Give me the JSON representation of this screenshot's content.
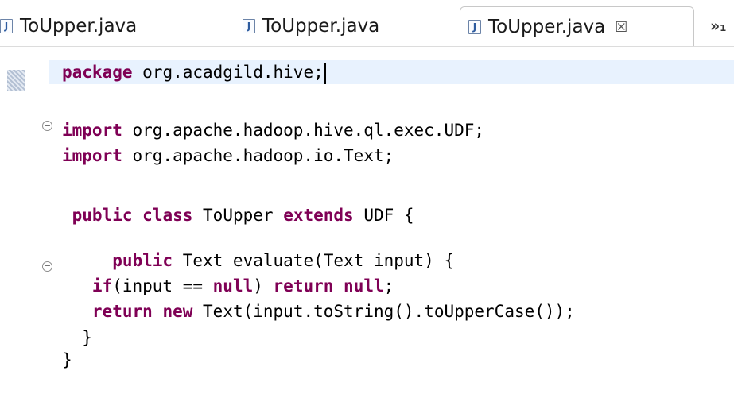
{
  "tabs": [
    {
      "label": "ToUpper.java",
      "icon": "java-file-icon",
      "active": false
    },
    {
      "label": "ToUpper.java",
      "icon": "java-file-icon",
      "active": false
    },
    {
      "label": "ToUpper.java",
      "icon": "java-file-icon",
      "active": true,
      "close_glyph": "☒"
    }
  ],
  "tab_icon_letter": "J",
  "more_tabs_label": "»₁",
  "colors": {
    "keyword": "#7f0055",
    "text": "#000000",
    "current_line_highlight": "#e8f2fe"
  },
  "code_lines": [
    {
      "tokens": [
        {
          "t": "package",
          "kw": true
        },
        {
          "t": " org.acadgild.hive;"
        }
      ]
    },
    {
      "tokens": []
    },
    {
      "tokens": [
        {
          "t": "import",
          "kw": true
        },
        {
          "t": " org.apache.hadoop.hive.ql.exec.UDF;"
        }
      ]
    },
    {
      "tokens": [
        {
          "t": "import",
          "kw": true
        },
        {
          "t": " org.apache.hadoop.io.Text;"
        }
      ]
    },
    {
      "tokens": []
    },
    {
      "tokens": [
        {
          "t": " public",
          "kw": true
        },
        {
          "t": " "
        },
        {
          "t": "class",
          "kw": true
        },
        {
          "t": " ToUpper "
        },
        {
          "t": "extends",
          "kw": true
        },
        {
          "t": " UDF {"
        }
      ]
    },
    {
      "tokens": []
    },
    {
      "tokens": [
        {
          "t": "     public",
          "kw": true
        },
        {
          "t": " Text evaluate(Text input) {"
        }
      ]
    },
    {
      "tokens": [
        {
          "t": "   if",
          "kw": true
        },
        {
          "t": "(input == "
        },
        {
          "t": "null",
          "kw": true
        },
        {
          "t": ") "
        },
        {
          "t": "return",
          "kw": true
        },
        {
          "t": " "
        },
        {
          "t": "null",
          "kw": true
        },
        {
          "t": ";"
        }
      ]
    },
    {
      "tokens": [
        {
          "t": "   return",
          "kw": true
        },
        {
          "t": " "
        },
        {
          "t": "new",
          "kw": true
        },
        {
          "t": " Text(input.toString().toUpperCase());"
        }
      ]
    },
    {
      "tokens": [
        {
          "t": "  }"
        }
      ]
    },
    {
      "tokens": [
        {
          "t": "}"
        }
      ]
    }
  ]
}
